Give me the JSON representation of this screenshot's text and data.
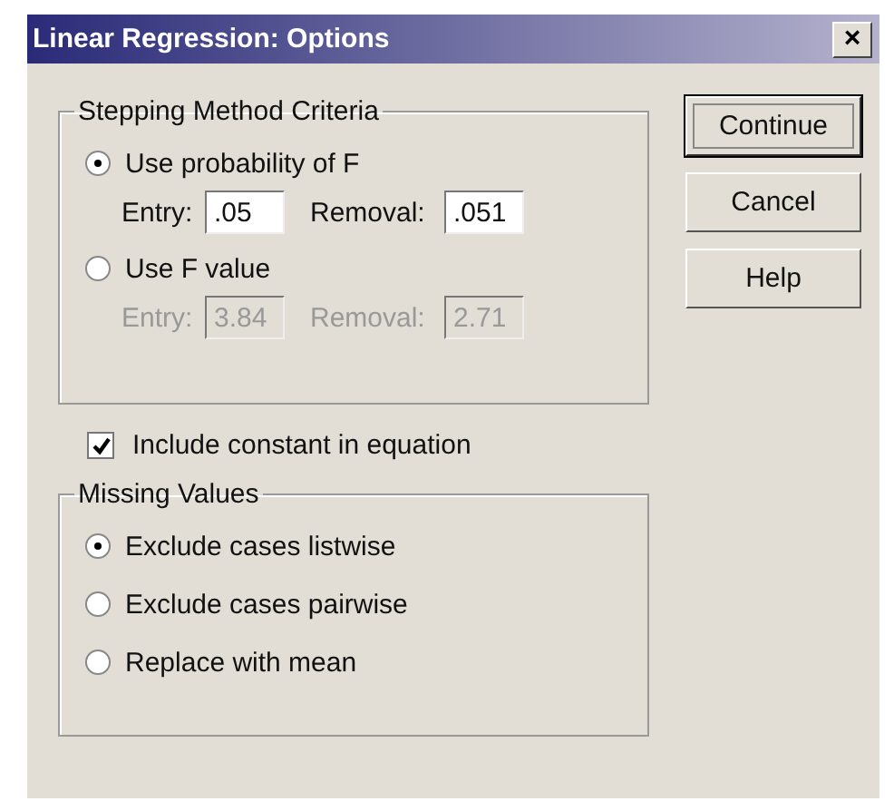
{
  "window": {
    "title": "Linear Regression: Options",
    "close": "×"
  },
  "stepping": {
    "title": "Stepping Method Criteria",
    "options": [
      {
        "label": "Use probability of F",
        "selected": true,
        "disabled": false,
        "entry_label": "Entry:",
        "entry_value": ".05",
        "removal_label": "Removal:",
        "removal_value": ".051"
      },
      {
        "label": "Use F value",
        "selected": false,
        "disabled": true,
        "entry_label": "Entry:",
        "entry_value": "3.84",
        "removal_label": "Removal:",
        "removal_value": "2.71"
      }
    ]
  },
  "include_constant": {
    "label": "Include constant in equation",
    "checked": true
  },
  "missing_values": {
    "title": "Missing Values",
    "options": [
      {
        "label": "Exclude cases listwise",
        "selected": true
      },
      {
        "label": "Exclude cases pairwise",
        "selected": false
      },
      {
        "label": "Replace with mean",
        "selected": false
      }
    ]
  },
  "buttons": [
    {
      "label": "Continue",
      "default": true
    },
    {
      "label": "Cancel",
      "default": false
    },
    {
      "label": "Help",
      "default": false
    }
  ]
}
